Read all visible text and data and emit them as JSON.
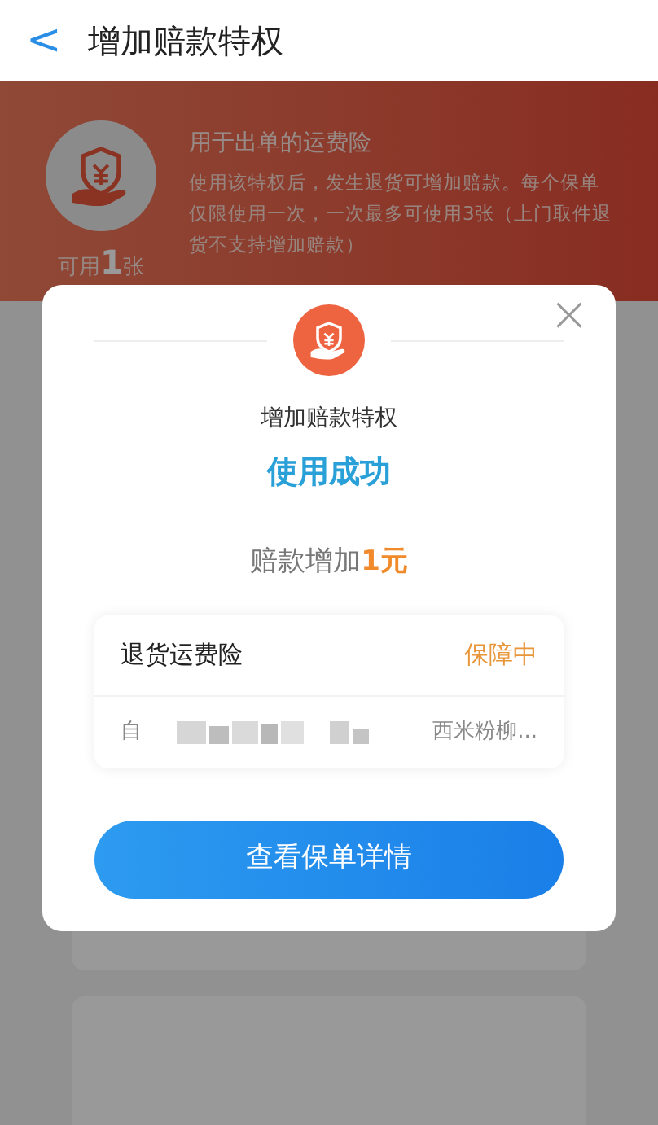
{
  "header": {
    "back": "<",
    "title": "增加赔款特权"
  },
  "banner": {
    "heading": "用于出单的运费险",
    "description": "使用该特权后，发生退货可增加赔款。每个保单仅限使用一次，一次最多可使用3张（上门取件退货不支持增加赔款）",
    "available": "可用**1**张"
  },
  "modal": {
    "close": "×",
    "title": "增加赔款特权",
    "status": "使用成功",
    "amount": "赔款增加**1元**",
    "policy": {
      "name": "退货运费险",
      "state": "保障中",
      "detail_prefix": "自",
      "detail_suffix": "西米粉柳..."
    },
    "button": "查看保单详情"
  }
}
